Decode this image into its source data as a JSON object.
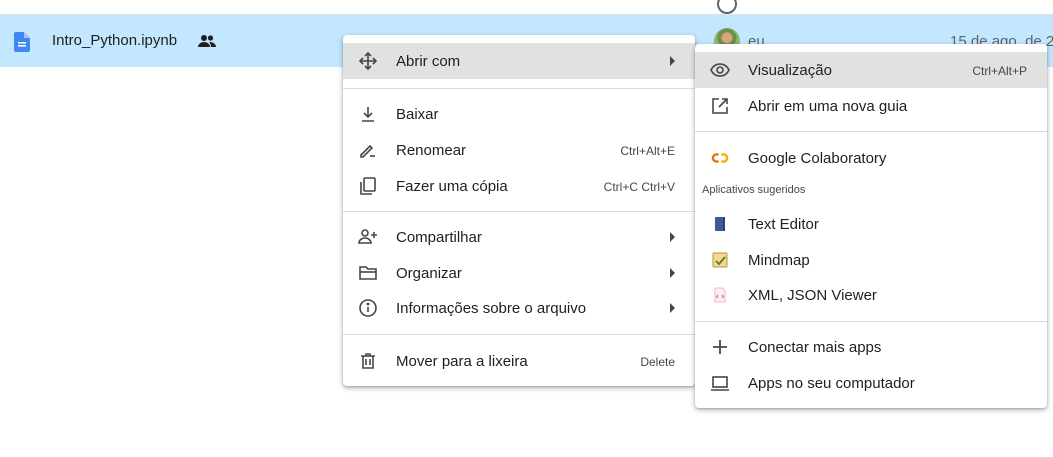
{
  "file": {
    "name": "Intro_Python.ipynb",
    "owner": "eu",
    "date": "15 de ago. de 2"
  },
  "menu": {
    "items": [
      {
        "label": "Abrir com"
      },
      {
        "label": "Baixar"
      },
      {
        "label": "Renomear",
        "shortcut": "Ctrl+Alt+E"
      },
      {
        "label": "Fazer uma cópia",
        "shortcut": "Ctrl+C Ctrl+V"
      },
      {
        "label": "Compartilhar"
      },
      {
        "label": "Organizar"
      },
      {
        "label": "Informações sobre o arquivo"
      },
      {
        "label": "Mover para a lixeira",
        "shortcut": "Delete"
      }
    ]
  },
  "submenu": {
    "items": [
      {
        "label": "Visualização",
        "shortcut": "Ctrl+Alt+P"
      },
      {
        "label": "Abrir em uma nova guia"
      },
      {
        "label": "Google Colaboratory"
      },
      {
        "label": "Text Editor"
      },
      {
        "label": "Mindmap"
      },
      {
        "label": "XML, JSON Viewer"
      },
      {
        "label": "Conectar mais apps"
      },
      {
        "label": "Apps no seu computador"
      }
    ],
    "suggested_label": "Aplicativos sugeridos"
  },
  "colors": {
    "selected_row": "#c2e7ff",
    "highlight": "#e1e1e1",
    "file_icon": "#4285f4",
    "colab_orange": "#f9ab00"
  }
}
